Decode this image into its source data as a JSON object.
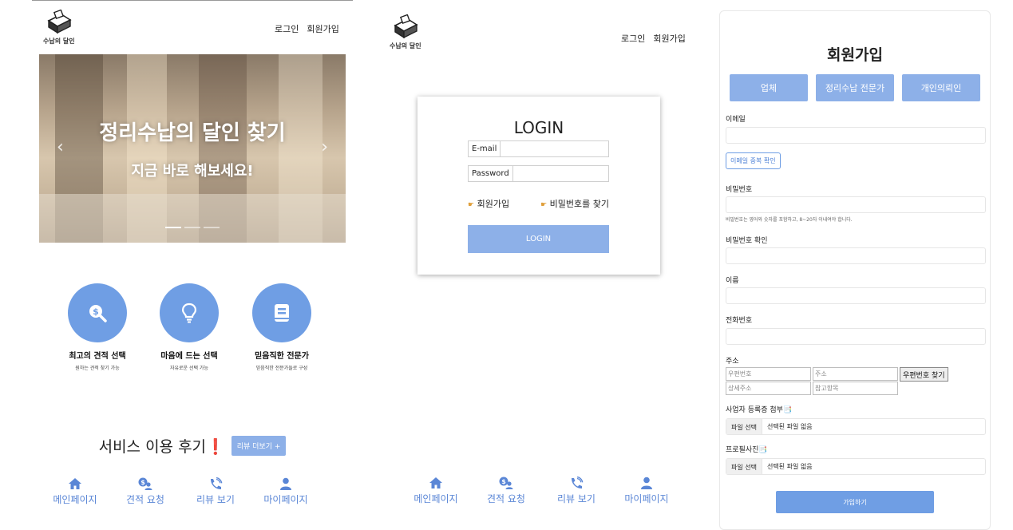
{
  "brand": {
    "logo_text": "수납의 달인"
  },
  "header": {
    "login_label": "로그인",
    "signup_label": "회원가입"
  },
  "carousel": {
    "title": "정리수납의 달인 찾기",
    "subtitle": "지금 바로 해보세요!",
    "slides": 3,
    "active_slide": 1
  },
  "features": [
    {
      "title": "최고의 견적 선택",
      "desc": "원하는 견적 찾기 가능",
      "icon": "dollar-search-icon"
    },
    {
      "title": "마음에 드는 선택",
      "desc": "자유로운 선택 가능",
      "icon": "lightbulb-icon"
    },
    {
      "title": "믿음직한 전문가",
      "desc": "믿음직한 전문가들로 구성",
      "icon": "book-icon"
    }
  ],
  "reviews": {
    "title": "서비스 이용 후기",
    "exclaim": "❗",
    "more_label": "리뷰 더보기 +"
  },
  "bottom_nav": [
    {
      "label": "메인페이지",
      "icon": "home-icon"
    },
    {
      "label": "견적 요청",
      "icon": "quote-request-icon"
    },
    {
      "label": "리뷰 보기",
      "icon": "phone-icon"
    },
    {
      "label": "마이페이지",
      "icon": "user-icon"
    }
  ],
  "login": {
    "title": "LOGIN",
    "email_label": "E-mail",
    "password_label": "Password",
    "signup_link": "회원가입",
    "find_password_link": "비밀번호를 찾기",
    "button": "LOGIN"
  },
  "signup": {
    "title": "회원가입",
    "tabs": [
      "업체",
      "정리수납 전문가",
      "개인의뢰인"
    ],
    "email_label": "이메일",
    "email_check_button": "이메일 중복 확인",
    "password_label": "비밀번호",
    "password_hint": "비밀번호는 영어와 숫자를 포함하고, 8~20자 이내여야 합니다.",
    "password_confirm_label": "비밀번호 확인",
    "name_label": "이름",
    "phone_label": "전화번호",
    "address_label": "주소",
    "postcode_placeholder": "우편번호",
    "address_placeholder": "주소",
    "find_postcode_button": "우편번호 찾기",
    "detail_address_placeholder": "상세주소",
    "extra_address_placeholder": "참고항목",
    "business_reg_label": "사업자 등록증 첨부📑",
    "profile_photo_label": "프로필사진📑",
    "file_button": "파일 선택",
    "file_none": "선택된 파일 없음",
    "submit_button": "가입하기"
  },
  "colors": {
    "accent": "#6f9ee4",
    "accent_light": "#8db0e8",
    "nav": "#5a86d6"
  }
}
